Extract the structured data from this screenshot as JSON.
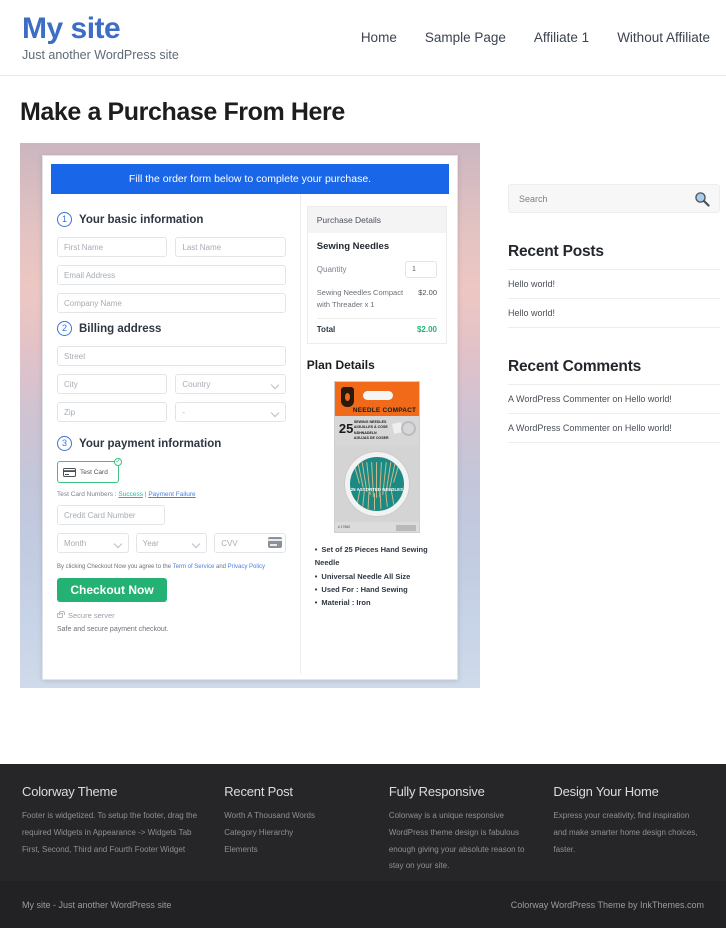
{
  "header": {
    "brand_title": "My site",
    "brand_tagline": "Just another WordPress site",
    "nav": [
      {
        "label": "Home"
      },
      {
        "label": "Sample Page"
      },
      {
        "label": "Affiliate 1"
      },
      {
        "label": "Without Affiliate"
      }
    ]
  },
  "main": {
    "page_title": "Make a Purchase From Here",
    "banner": "Fill the order form below to complete your purchase.",
    "steps": {
      "one_num": "1",
      "one_label": "Your basic information",
      "two_num": "2",
      "two_label": "Billing address",
      "three_num": "3",
      "three_label": "Your payment information"
    },
    "fields": {
      "first_name": "First Name",
      "last_name": "Last Name",
      "email": "Email Address",
      "company": "Company Name",
      "street": "Street",
      "city": "City",
      "country": "Country",
      "zip": "Zip",
      "state": "-",
      "credit_card": "Credit Card Number",
      "month": "Month",
      "year": "Year",
      "cvv": "CVV"
    },
    "payment": {
      "card_tab_label": "Test Card",
      "check_glyph": "✓",
      "test_prefix": "Test Card Numbers : ",
      "test_success": "Success",
      "test_divider": " | ",
      "test_failure": "Payment Failure",
      "terms_prefix": "By clicking Checkout Now you agree to the ",
      "terms_link1": "Term of Service",
      "terms_and": " and ",
      "terms_link2": "Privacy Policy",
      "checkout_button": "Checkout Now",
      "secure_server": "Secure server",
      "safe_note": "Safe and secure payment checkout."
    },
    "purchase_details": {
      "header": "Purchase Details",
      "product_title": "Sewing Needles",
      "quantity_label": "Quantity",
      "quantity_value": "1",
      "line_item": "Sewing Needles Compact with Threader x 1",
      "line_price": "$2.00",
      "total_label": "Total",
      "total_value": "$2.00"
    },
    "plan_details": {
      "title": "Plan Details",
      "package": {
        "brand_text": "NEEDLE COMPACT",
        "count": "25",
        "languages": "SEWING NEEDLES\nAIGUILLES À COSE\nNÄHNADELN\nAGUJAS DE COSER",
        "disc_label": "25 ASSORTED NEEDLES",
        "sku": "# 17660"
      },
      "features": [
        "Set of 25 Pieces Hand Sewing Needle",
        "Universal Needle All Size",
        "Used For : Hand Sewing",
        "Material : Iron"
      ]
    }
  },
  "sidebar": {
    "search_placeholder": "Search",
    "recent_posts_title": "Recent Posts",
    "recent_posts": [
      {
        "label": "Hello world!"
      },
      {
        "label": "Hello world!"
      }
    ],
    "recent_comments_title": "Recent Comments",
    "recent_comments": [
      {
        "label": "A WordPress Commenter on Hello world!"
      },
      {
        "label": "A WordPress Commenter on Hello world!"
      }
    ]
  },
  "footer": {
    "columns": [
      {
        "title": "Colorway Theme",
        "text": "Footer is widgetized. To setup the footer, drag the required Widgets in Appearance -> Widgets Tab First, Second, Third and Fourth Footer Widget"
      },
      {
        "title": "Recent Post",
        "items": [
          {
            "label": "Worth A Thousand Words"
          },
          {
            "label": "Category Hierarchy"
          },
          {
            "label": "Elements"
          }
        ]
      },
      {
        "title": "Fully Responsive",
        "text": "Colorway is a unique responsive WordPress theme design is fabulous enough giving your absolute reason to stay on your site."
      },
      {
        "title": "Design Your Home",
        "text": "Express your creativity, find inspiration and make smarter home design choices, faster."
      }
    ],
    "bottom_left": "My site - Just another WordPress site",
    "bottom_right": "Colorway WordPress Theme by InkThemes.com"
  },
  "colors": {
    "brand": "#3d6dc4",
    "banner_blue": "#1a66e8",
    "checkout_green": "#23b273",
    "total_green": "#22b573",
    "footer_bg": "#262628"
  }
}
